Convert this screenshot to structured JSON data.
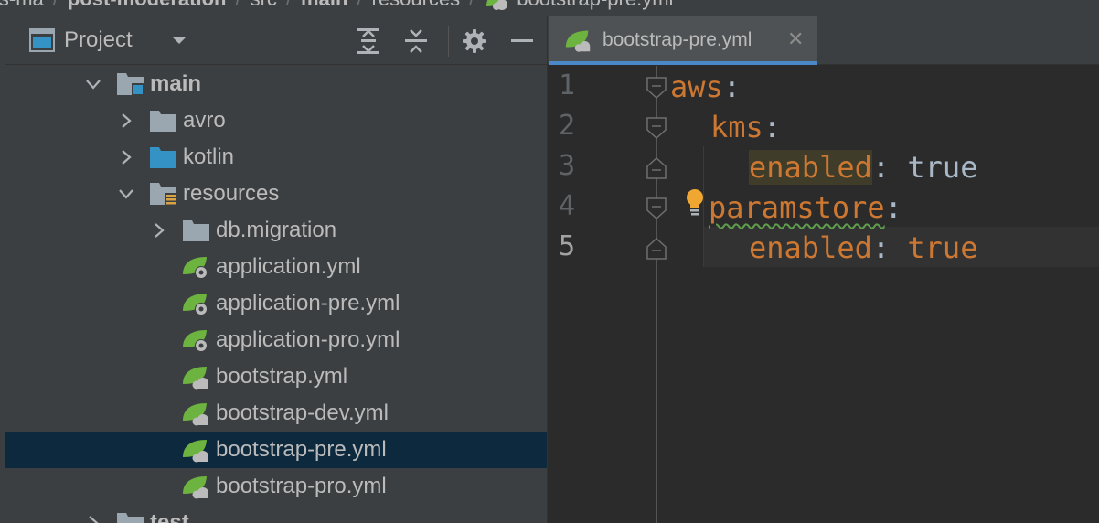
{
  "breadcrumb": {
    "items": [
      "ls-ma",
      "post-moderation",
      "src",
      "main",
      "resources",
      "bootstrap-pre.yml"
    ]
  },
  "project_panel": {
    "title": "Project",
    "toolbar_icons": [
      "expand-all-icon",
      "collapse-all-icon",
      "gear-icon",
      "minimize-icon"
    ]
  },
  "tree": {
    "items": [
      {
        "label": "main",
        "bold": true,
        "chevron": "down",
        "icon": "source-root-folder-icon"
      },
      {
        "label": "avro",
        "chevron": "right",
        "icon": "folder-icon"
      },
      {
        "label": "kotlin",
        "chevron": "right",
        "icon": "source-folder-icon"
      },
      {
        "label": "resources",
        "chevron": "down",
        "icon": "resources-folder-icon"
      },
      {
        "label": "db.migration",
        "chevron": "right",
        "icon": "folder-icon"
      },
      {
        "label": "application.yml",
        "icon": "spring-config-icon"
      },
      {
        "label": "application-pre.yml",
        "icon": "spring-config-icon"
      },
      {
        "label": "application-pro.yml",
        "icon": "spring-config-icon"
      },
      {
        "label": "bootstrap.yml",
        "icon": "spring-bootstrap-icon"
      },
      {
        "label": "bootstrap-dev.yml",
        "icon": "spring-bootstrap-icon"
      },
      {
        "label": "bootstrap-pre.yml",
        "icon": "spring-bootstrap-icon",
        "selected": true
      },
      {
        "label": "bootstrap-pro.yml",
        "icon": "spring-bootstrap-icon"
      },
      {
        "label": "test",
        "bold": true,
        "chevron": "right",
        "icon": "folder-icon"
      }
    ]
  },
  "editor": {
    "tab": {
      "label": "bootstrap-pre.yml",
      "close": "✕"
    },
    "lines": [
      {
        "num": "1",
        "key": "aws",
        "colon": ":"
      },
      {
        "num": "2",
        "key": "kms",
        "colon": ":"
      },
      {
        "num": "3",
        "key": "enabled",
        "colon": ":",
        "value": "true"
      },
      {
        "num": "4",
        "key": "paramstore",
        "colon": ":"
      },
      {
        "num": "5",
        "key": "enabled",
        "colon": ":",
        "value": "true"
      }
    ],
    "current_line": "5"
  },
  "colors": {
    "panel_bg": "#3c3f41",
    "editor_bg": "#2b2b2b",
    "selection": "#0d293e",
    "tab_underline": "#4a88c7",
    "yaml_key": "#cc7832",
    "spring_green": "#6db33f"
  }
}
